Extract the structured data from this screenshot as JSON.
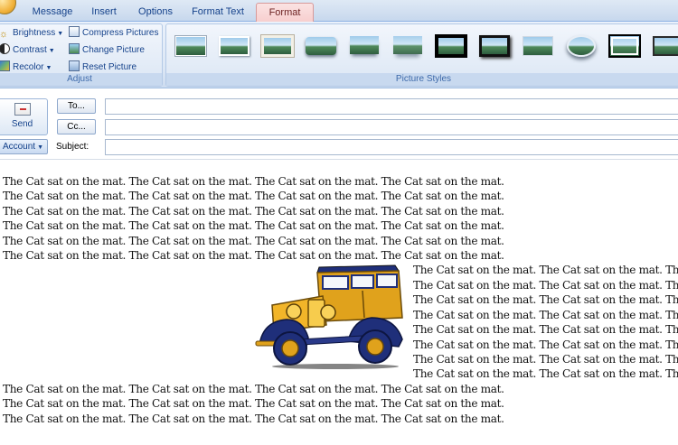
{
  "tabs": [
    {
      "label": "Message"
    },
    {
      "label": "Insert"
    },
    {
      "label": "Options"
    },
    {
      "label": "Format Text"
    },
    {
      "label": "Format",
      "active": true
    }
  ],
  "adjust_group": {
    "label": "Adjust",
    "brightness": "Brightness",
    "contrast": "Contrast",
    "recolor": "Recolor",
    "compress": "Compress Pictures",
    "change": "Change Picture",
    "reset": "Reset Picture"
  },
  "styles_group": {
    "label": "Picture Styles",
    "thumbnail_count": 12
  },
  "compose": {
    "send": "Send",
    "to": "To...",
    "cc": "Cc...",
    "account": "Account",
    "subject": "Subject:"
  },
  "body": {
    "full_line": "The Cat sat on the mat. The Cat sat on the mat. The Cat sat on the mat. The Cat sat on the mat.",
    "wrap_line": "The Cat sat on the mat. The Cat sat on the mat. Th"
  },
  "colors": {
    "ribbon_blue": "#dce7f5",
    "active_tab": "#f7cfcf",
    "label_text": "#15428b"
  }
}
